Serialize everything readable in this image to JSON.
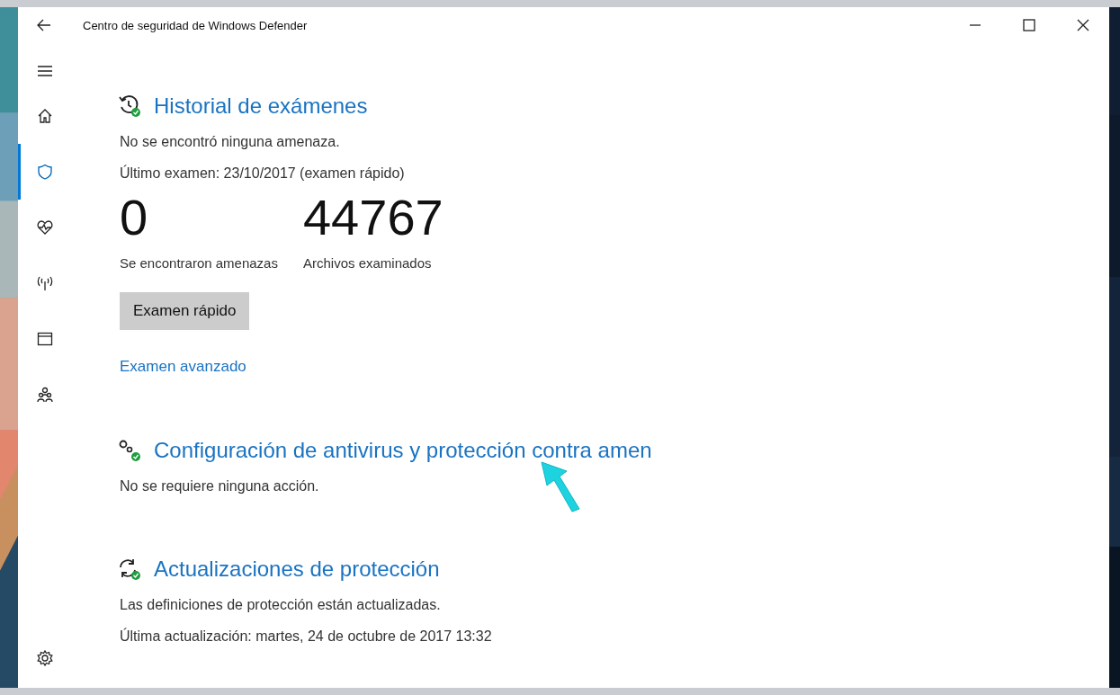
{
  "window": {
    "title": "Centro de seguridad de Windows Defender"
  },
  "nav": [
    {
      "selected": false
    },
    {
      "selected": false
    },
    {
      "selected": true
    },
    {
      "selected": false
    },
    {
      "selected": false
    },
    {
      "selected": false
    },
    {
      "selected": false
    }
  ],
  "sections": [
    {
      "heading": "Historial de exámenes",
      "lines": [
        "No se encontró ninguna amenaza.",
        "Último examen: 23/10/2017 (examen rápido)"
      ],
      "stats": [
        {
          "value": "0",
          "label": "Se encontraron amenazas"
        },
        {
          "value": "44767",
          "label": "Archivos examinados"
        }
      ],
      "button": "Examen rápido",
      "link": "Examen avanzado"
    },
    {
      "heading": "Configuración de antivirus y protección contra amen",
      "lines": [
        "No se requiere ninguna acción."
      ]
    },
    {
      "heading": "Actualizaciones de protección",
      "lines": [
        "Las definiciones de protección están actualizadas.",
        "Última actualización: martes, 24 de octubre de 2017 13:32"
      ]
    }
  ]
}
